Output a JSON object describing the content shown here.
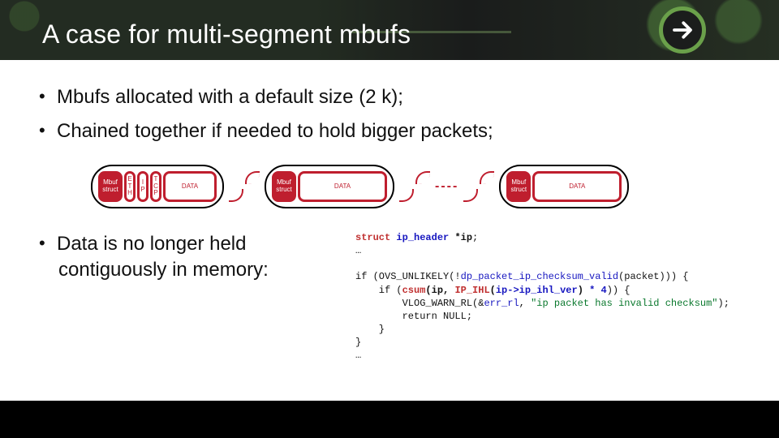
{
  "title": "A case for multi-segment mbufs",
  "bullets": {
    "b1": "Mbufs allocated with a default size (2 k);",
    "b2": "Chained together if needed to hold bigger packets;",
    "b3a": "Data is no longer held",
    "b3b": "contiguously in memory:"
  },
  "diagram": {
    "struct": "Mbuf struct",
    "eth": "E T H",
    "ip": "I P",
    "tcp": "T C P",
    "data": "DATA",
    "dots": "----"
  },
  "code": {
    "l1a": "struct",
    "l1b": " ip_header ",
    "l1c": "*ip",
    "l1d": ";",
    "l2": "…",
    "l3a": "if (OVS_UNLIKELY(!",
    "l3b": "dp_packet_ip_checksum_valid",
    "l3c": "(packet))) {",
    "l4a": "    if (",
    "l4b": "csum",
    "l4c": "(ip, ",
    "l4d": "IP_IHL",
    "l4e": "(",
    "l4f": "ip->ip_ihl_ver",
    "l4g": ") ",
    "l4h": "* 4",
    "l4i": ")) {",
    "l5a": "        VLOG_WARN_RL(&",
    "l5b": "err_rl",
    "l5c": ", ",
    "l5d": "\"ip packet has invalid checksum\"",
    "l5e": ");",
    "l6": "        return NULL;",
    "l7": "    }",
    "l8": "}",
    "l9": "…"
  }
}
